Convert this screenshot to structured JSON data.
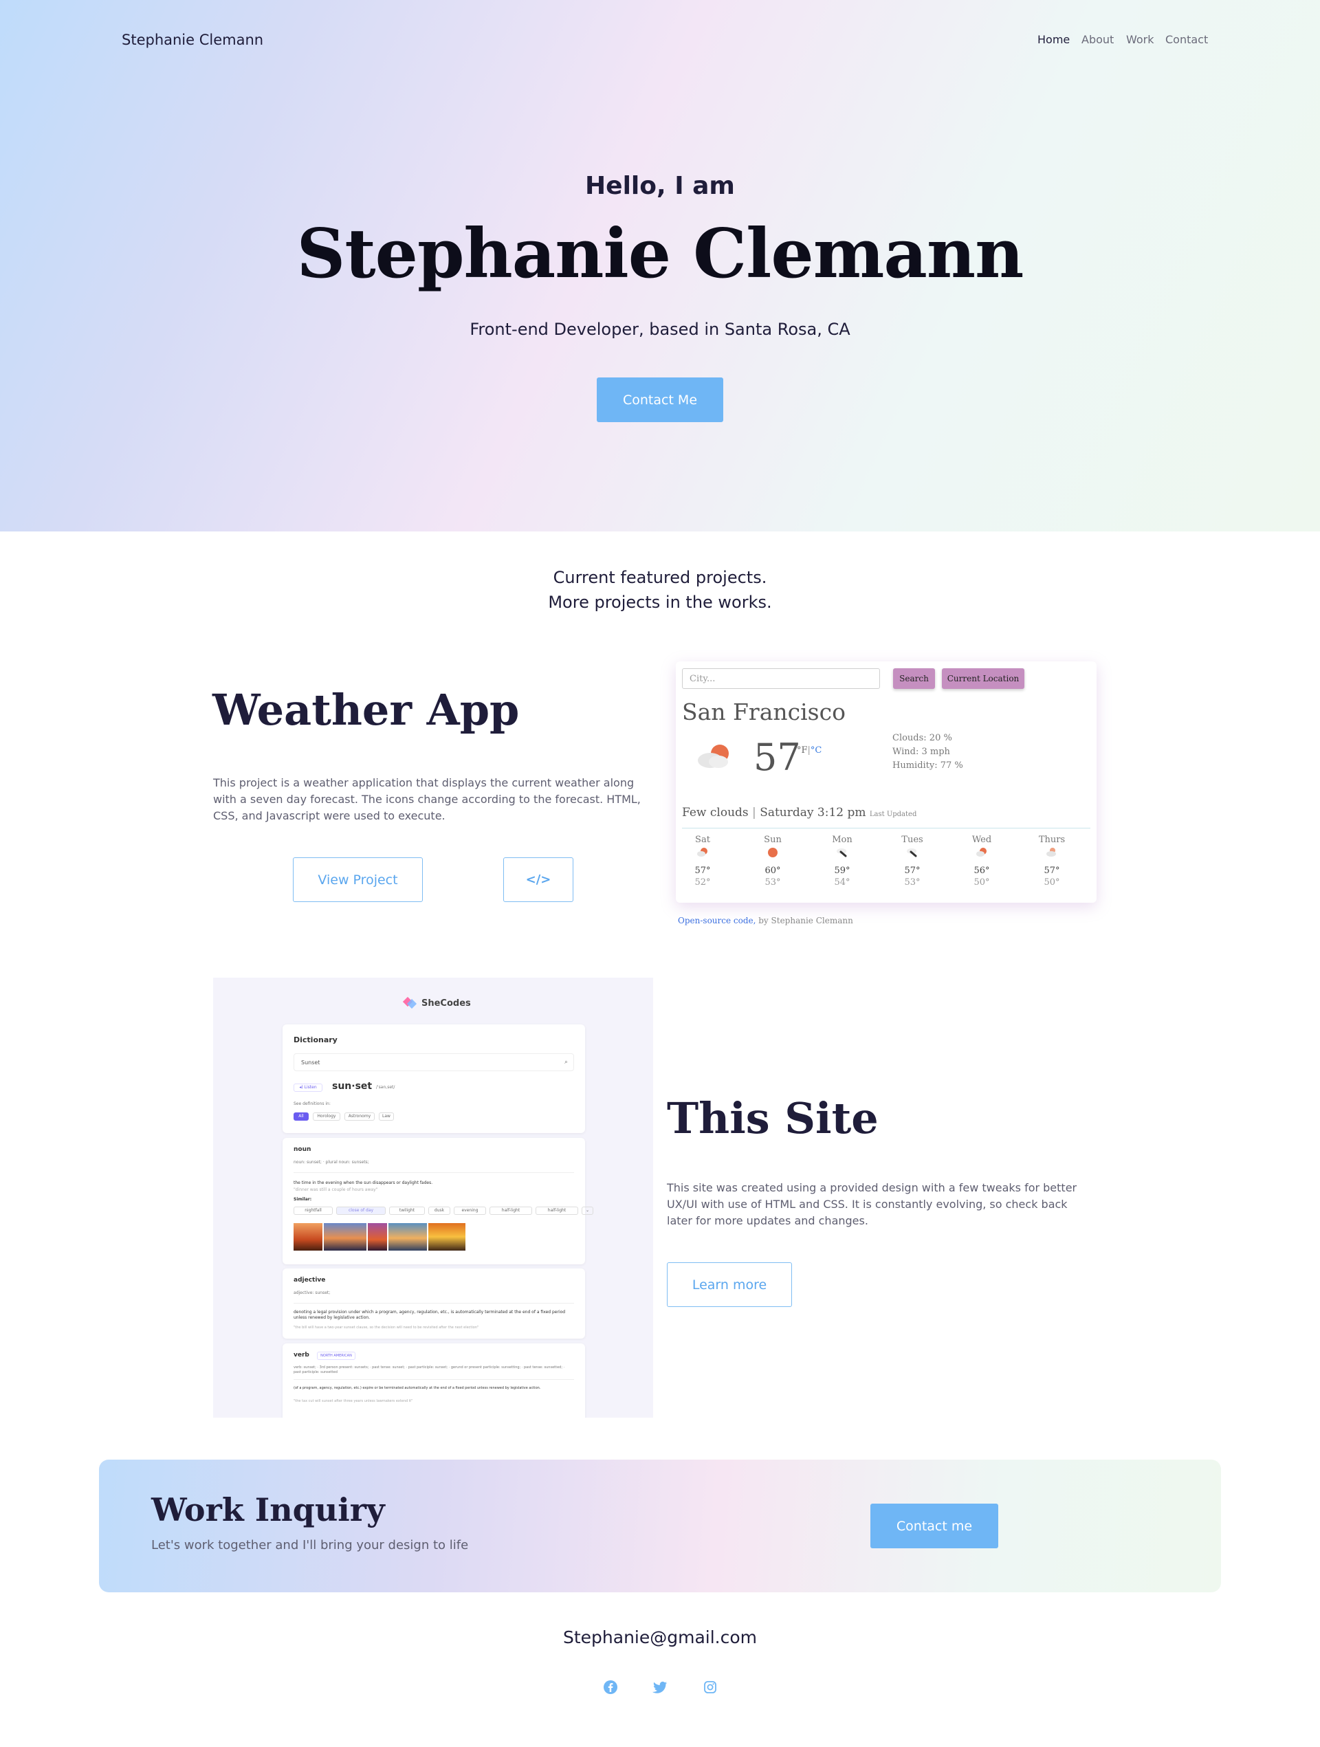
{
  "header": {
    "brand": "Stephanie Clemann",
    "nav": [
      "Home",
      "About",
      "Work",
      "Contact"
    ]
  },
  "hero": {
    "greeting": "Hello, I am",
    "name": "Stephanie Clemann",
    "subtitle": "Front-end Developer, based in Santa Rosa, CA",
    "cta": "Contact Me"
  },
  "featured": {
    "line1": "Current featured projects.",
    "line2": "More projects in the works."
  },
  "weather_project": {
    "title": "Weather App",
    "description": "This project is a weather application that displays the current weather along with a seven day forecast. The icons change according to the forecast. HTML, CSS, and Javascript were used to execute.",
    "view_label": "View Project",
    "code_label": "</>",
    "app": {
      "city_placeholder": "City...",
      "search_label": "Search",
      "location_label": "Current Location",
      "city": "San Francisco",
      "temp": "57",
      "unit_f": "°F",
      "unit_sep": "|",
      "unit_c": "°C",
      "clouds": "Clouds: 20 %",
      "wind": "Wind: 3 mph",
      "humidity": "Humidity: 77 %",
      "description": "Few clouds",
      "datetime": "Saturday 3:12 pm",
      "updated": "Last Updated",
      "forecast": [
        {
          "day": "Sat",
          "high": "57°",
          "low": "52°",
          "icon": "partly-sunny"
        },
        {
          "day": "Sun",
          "high": "60°",
          "low": "53°",
          "icon": "sunny"
        },
        {
          "day": "Mon",
          "high": "59°",
          "low": "54°",
          "icon": "rain"
        },
        {
          "day": "Tues",
          "high": "57°",
          "low": "53°",
          "icon": "rain"
        },
        {
          "day": "Wed",
          "high": "56°",
          "low": "50°",
          "icon": "partly-sunny"
        },
        {
          "day": "Thurs",
          "high": "57°",
          "low": "50°",
          "icon": "partly-cloudy"
        }
      ],
      "footer_link": "Open-source code,",
      "footer_by": " by Stephanie Clemann"
    }
  },
  "site_project": {
    "title": "This Site",
    "description": "This site was created using a provided design with a few tweaks for better UX/UI with use of HTML and CSS. It is constantly evolving, so check back later for more updates and changes.",
    "learn_label": "Learn more",
    "dictionary": {
      "logo": "SheCodes",
      "heading": "Dictionary",
      "search_value": "Sunset",
      "listen": "Listen",
      "word": "sun·set",
      "phonetic": "/ˈsən,set/",
      "see_defs": "See definitions in:",
      "tags": [
        "All",
        "Horology",
        "Astronomy",
        "Law"
      ],
      "noun": "noun",
      "noun_forms": "noun: sunset;  ·  plural noun: sunsets;",
      "noun_def": "the time in the evening when the sun disappears or daylight fades.",
      "noun_example": "\"dinner was still a couple of hours away\"",
      "similar": "Similar:",
      "similar_words": [
        "nightfall",
        "close of day",
        "twilight",
        "dusk",
        "evening",
        "half-light",
        "half-light",
        "⌄"
      ],
      "adjective": "adjective",
      "adj_forms": "adjective: sunset;",
      "adj_def": "denoting a legal provision under which a program, agency, regulation, etc., is automatically terminated at the end of a fixed period unless renewed by legislative action.",
      "adj_example": "\"the bill will have a two-year sunset clause, so the decision will need to be revisited after the next election\"",
      "verb": "verb",
      "verb_tag": "NORTH AMERICAN",
      "verb_forms": "verb: sunset;  ·  3rd person present: sunsets;  ·  past tense: sunset;  ·  past participle: sunset;  ·  gerund or present participle: sunsetting;  ·  past tense: sunsetted;  ·  past participle: sunsetted",
      "verb_def": "(of a program, agency, regulation, etc.) expire or be terminated automatically at the end of a fixed period unless renewed by legislative action.",
      "verb_example": "\"the tax cut will sunset after three years unless lawmakers extend it\""
    }
  },
  "inquiry": {
    "title": "Work Inquiry",
    "subtitle": "Let's work together and I'll bring your design to life",
    "cta": "Contact me"
  },
  "footer": {
    "email": "Stephanie@gmail.com",
    "social": [
      "facebook-icon",
      "twitter-icon",
      "instagram-icon"
    ]
  },
  "colors": {
    "accent": "#6fb6f5",
    "heading": "#1f1d3a",
    "weather_button": "#c58fc0"
  }
}
